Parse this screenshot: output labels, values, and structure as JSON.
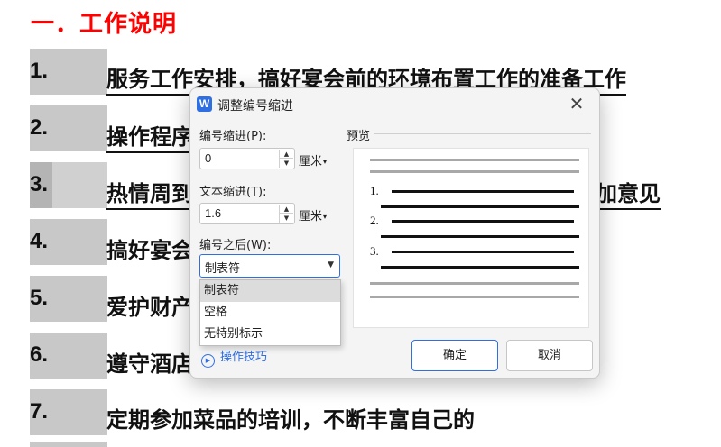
{
  "document": {
    "heading": "一．工作说明",
    "rows": [
      {
        "num": "1.",
        "text": "服务工作安排，搞好宴会前的环境布置工作的准备工作"
      },
      {
        "num": "2.",
        "text": "操作程序"
      },
      {
        "num": "3.",
        "text": "热情周到",
        "text_right": "加意见"
      },
      {
        "num": "4.",
        "text": "搞好宴会"
      },
      {
        "num": "5.",
        "text": "爱护财产"
      },
      {
        "num": "6.",
        "text": "遵守酒店"
      },
      {
        "num": "7.",
        "text": "定期参加菜品的培训，不断丰富自己的"
      }
    ]
  },
  "dialog": {
    "app_icon": "W",
    "title": "调整编号缩进",
    "number_indent": {
      "label": "编号缩进(P):",
      "value": "0",
      "unit": "厘米"
    },
    "text_indent": {
      "label": "文本缩进(T):",
      "value": "1.6",
      "unit": "厘米"
    },
    "after_number": {
      "label": "编号之后(W):",
      "selected": "制表符",
      "options": [
        "制表符",
        "空格",
        "无特别标示"
      ]
    },
    "preview": {
      "label": "预览",
      "numbers": [
        "1.",
        "2.",
        "3."
      ]
    },
    "tips_label": "操作技巧",
    "ok_label": "确定",
    "cancel_label": "取消"
  },
  "colors": {
    "heading": "#ff0000",
    "accent": "#2f6fe4",
    "number_cell": "#c8c8c8"
  },
  "icons": {
    "app": "wps-writer-icon",
    "close": "close-icon",
    "spin_up": "triangle-up-icon",
    "spin_down": "triangle-down-icon",
    "dropdown": "chevron-down-icon",
    "tips": "play-circle-icon"
  }
}
